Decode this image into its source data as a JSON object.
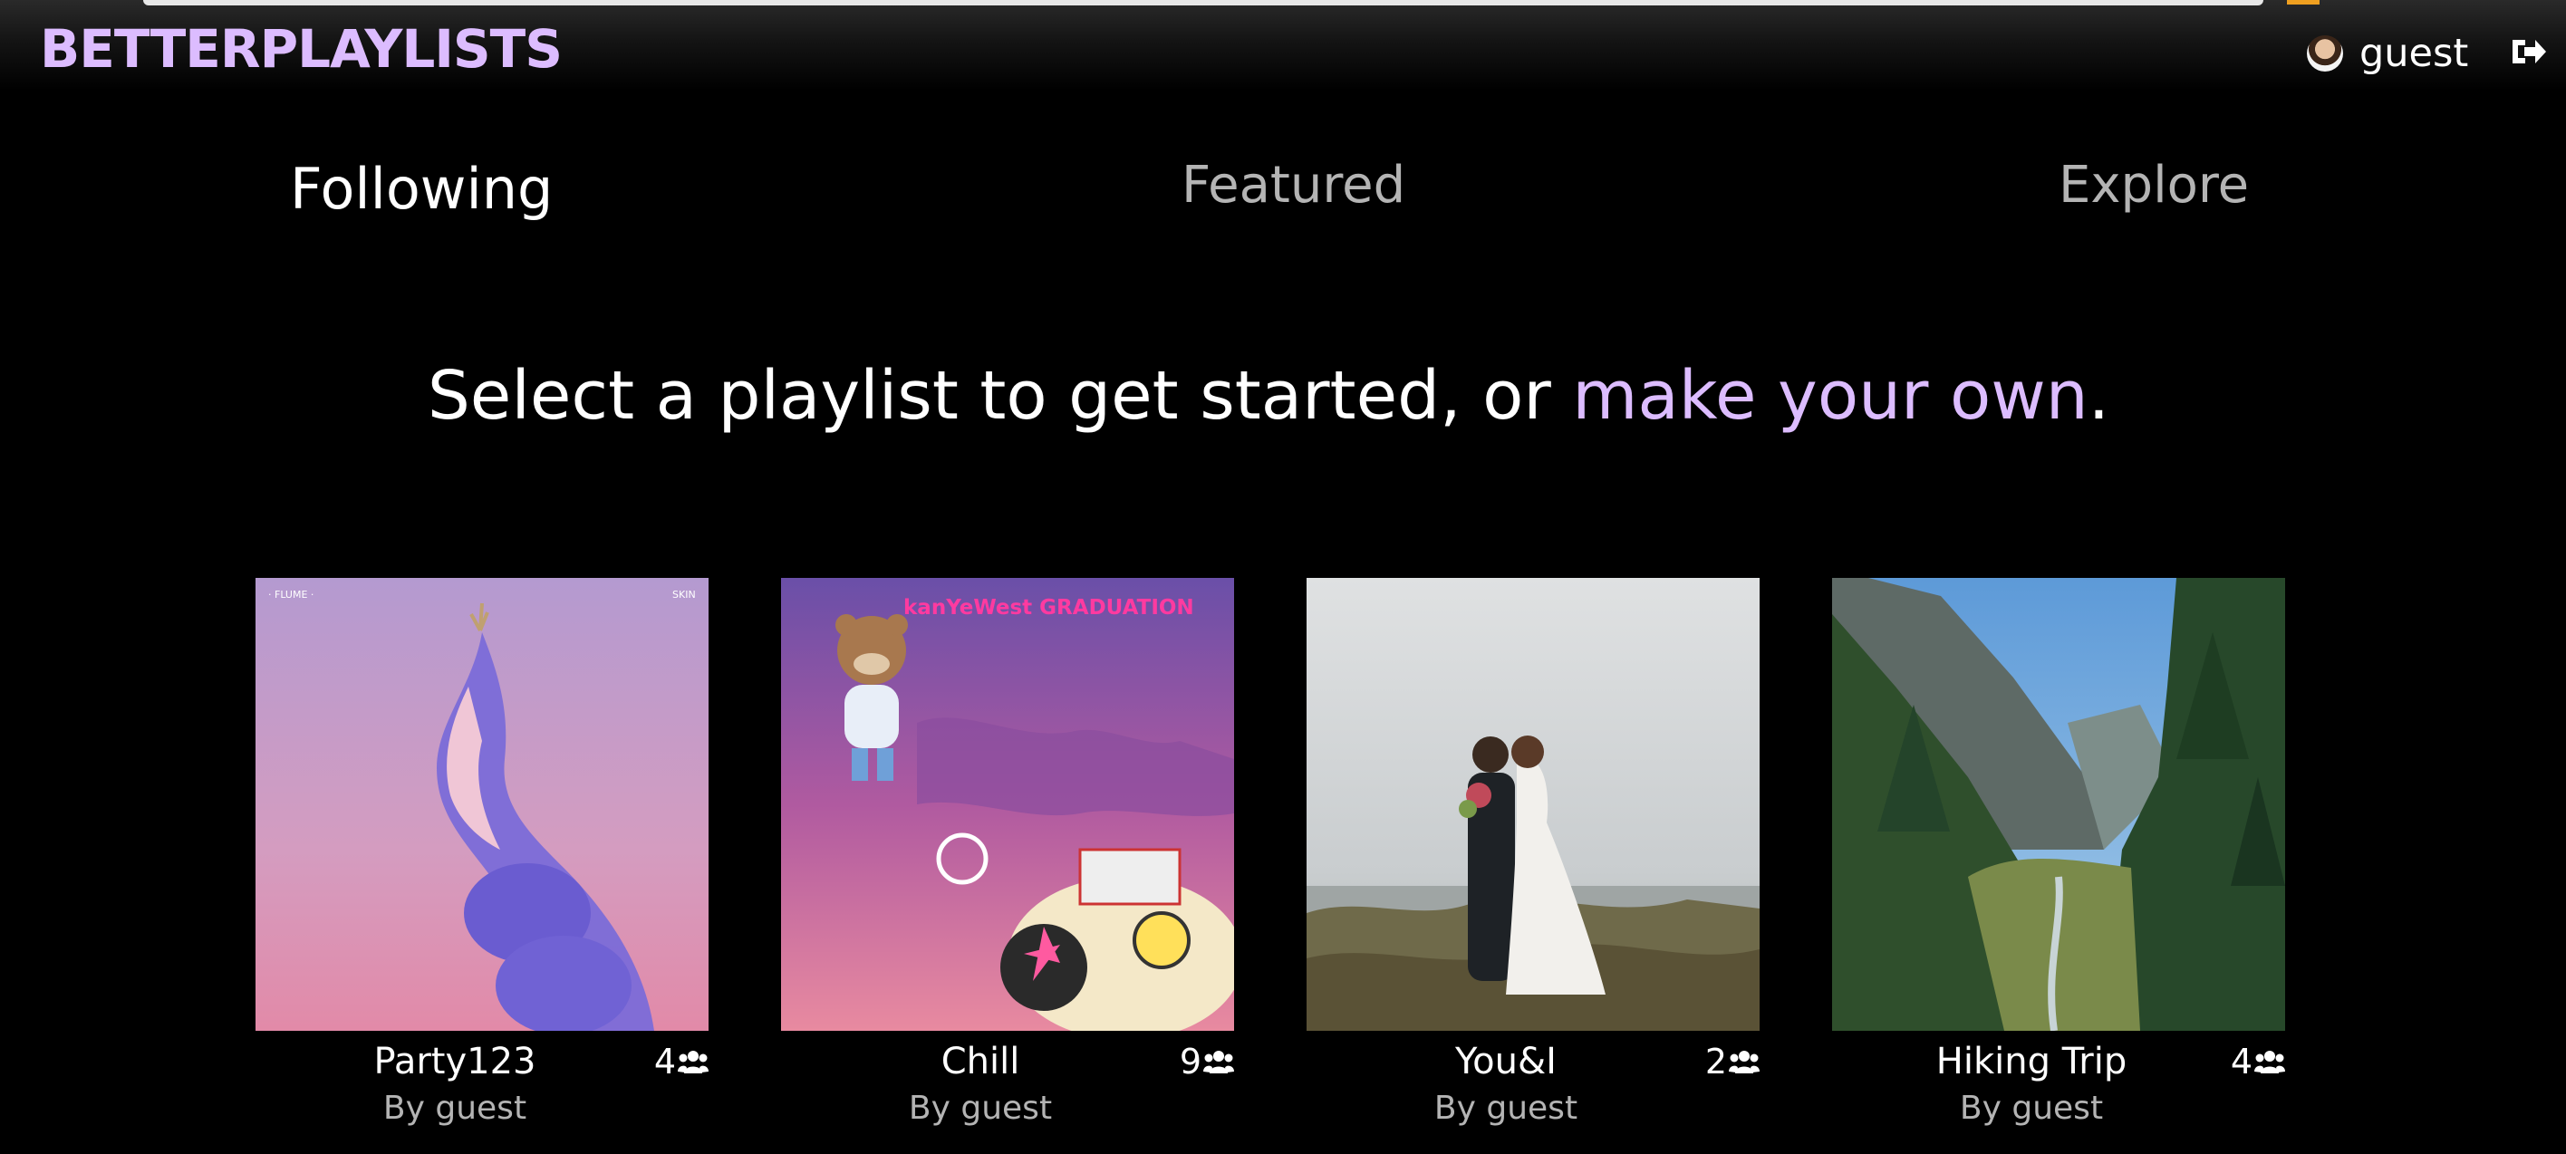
{
  "app": {
    "logo": "BETTERPLAYLISTS",
    "accent_color": "#dcbcff"
  },
  "user": {
    "name": "guest",
    "avatar_icon": "user-avatar",
    "logout_icon": "sign-out-icon"
  },
  "tabs": [
    {
      "label": "Following",
      "active": true
    },
    {
      "label": "Featured",
      "active": false
    },
    {
      "label": "Explore",
      "active": false
    }
  ],
  "headline": {
    "prefix": "Select a playlist to get started, or ",
    "link": "make your own",
    "suffix": "."
  },
  "playlists": [
    {
      "title": "Party123",
      "followers": "4",
      "author": "By guest",
      "cover": "album-cover-flume-skin",
      "cover_text": [
        "· FLUME ·",
        "SKIN"
      ]
    },
    {
      "title": "Chill",
      "followers": "9",
      "author": "By guest",
      "cover": "album-cover-graduation",
      "cover_text": [
        "kanYeWest GRADUATION"
      ]
    },
    {
      "title": "You&I",
      "followers": "2",
      "author": "By guest",
      "cover": "wedding-couple-photo"
    },
    {
      "title": "Hiking Trip",
      "followers": "4",
      "author": "By guest",
      "cover": "mountain-valley-photo"
    }
  ]
}
